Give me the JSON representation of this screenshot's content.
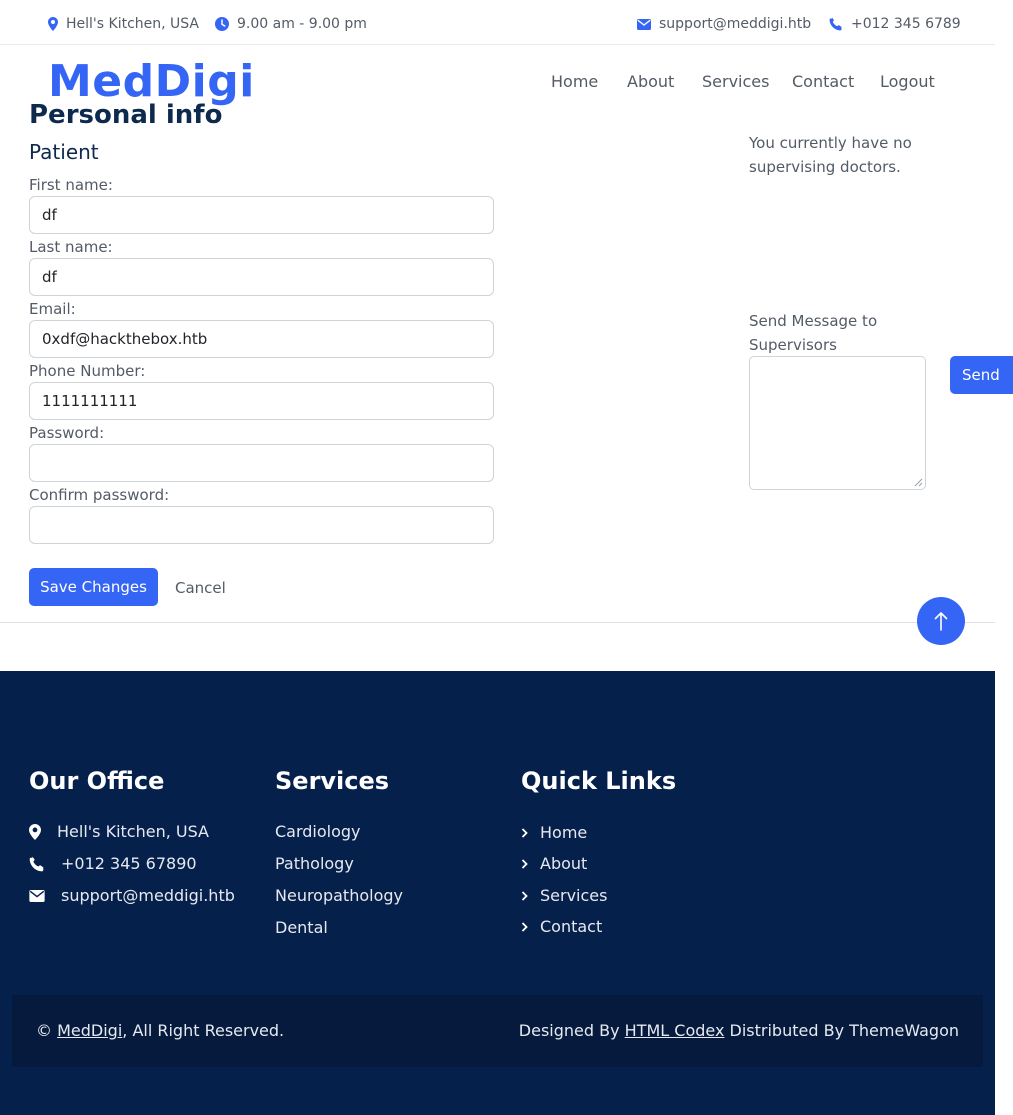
{
  "topbar": {
    "location": "Hell's Kitchen, USA",
    "hours": "9.00 am - 9.00 pm",
    "email": "support@meddigi.htb",
    "phone": "+012 345 6789"
  },
  "navbar": {
    "brand": "MedDigi",
    "links": [
      "Home",
      "About",
      "Services",
      "Contact",
      "Logout"
    ]
  },
  "profile": {
    "title": "Personal info",
    "role": "Patient",
    "fields": {
      "first_name": {
        "label": "First name:",
        "value": "df"
      },
      "last_name": {
        "label": "Last name:",
        "value": "df"
      },
      "email": {
        "label": "Email:",
        "value": "0xdf@hackthebox.htb"
      },
      "phone": {
        "label": "Phone Number:",
        "value": "1111111111"
      },
      "password": {
        "label": "Password:",
        "value": ""
      },
      "confirm_password": {
        "label": "Confirm password:",
        "value": ""
      }
    },
    "save_label": "Save Changes",
    "cancel_label": "Cancel"
  },
  "supervisors": {
    "status": "You currently have no supervising doctors.",
    "message_label": "Send Message to Supervisors",
    "message_value": "",
    "send_label": "Send"
  },
  "footer": {
    "office": {
      "heading": "Our Office",
      "address": "Hell's Kitchen, USA",
      "phone": "+012 345 67890",
      "email": "support@meddigi.htb"
    },
    "services": {
      "heading": "Services",
      "items": [
        "Cardiology",
        "Pathology",
        "Neuropathology",
        "Dental"
      ]
    },
    "quick_links": {
      "heading": "Quick Links",
      "items": [
        "Home",
        "About",
        "Services",
        "Contact"
      ]
    },
    "copyright": {
      "symbol": "©",
      "brand": "MedDigi",
      "rights": ", All Right Reserved.",
      "designed_by": "Designed By",
      "designer": "HTML Codex",
      "distributed_by": "Distributed By ThemeWagon"
    }
  },
  "colors": {
    "accent": "#3565f5",
    "footer_bg": "#06204c",
    "heading": "#0d2a4e"
  },
  "icons": [
    "map-marker-icon",
    "clock-icon",
    "envelope-icon",
    "phone-icon",
    "arrow-up-icon",
    "chevron-right-icon"
  ]
}
